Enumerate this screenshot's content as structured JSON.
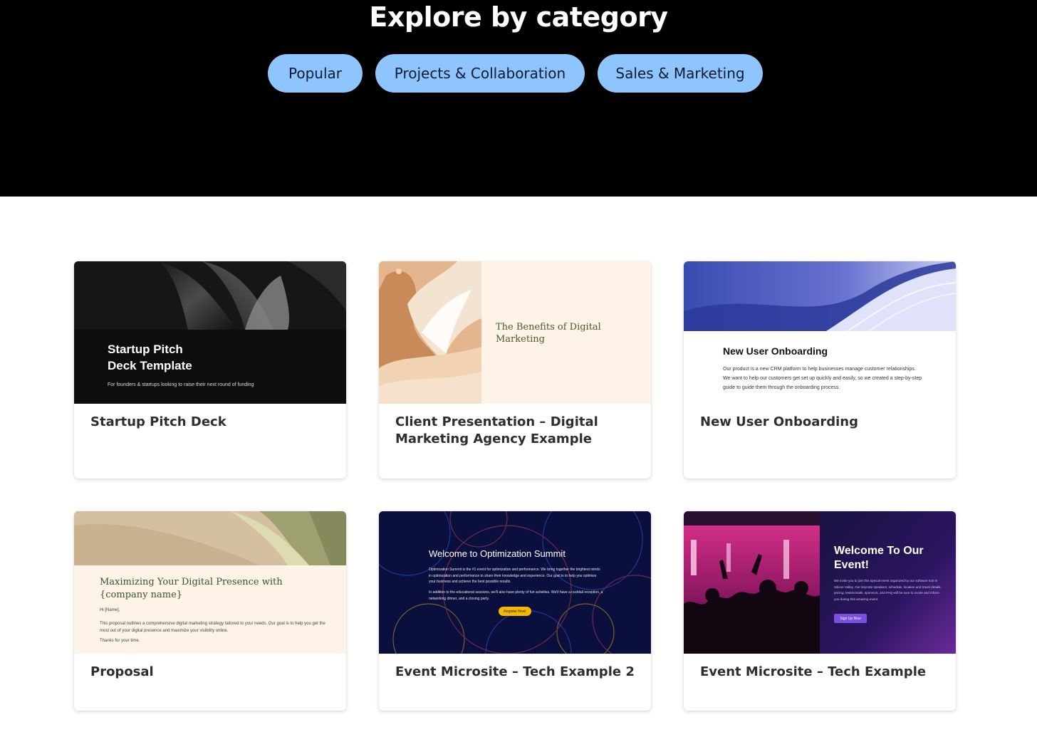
{
  "hero": {
    "title": "Explore by category",
    "categories": [
      "Popular",
      "Projects & Collaboration",
      "Sales & Marketing"
    ]
  },
  "cards": [
    {
      "title": "Startup Pitch Deck",
      "thumb": {
        "heading_line1": "Startup Pitch",
        "heading_line2": "Deck Template",
        "subtitle": "For founders & startups looking to raise their next round of funding"
      }
    },
    {
      "title": "Client Presentation – Digital Marketing Agency Example",
      "thumb": {
        "heading": "The Benefits of Digital Marketing"
      }
    },
    {
      "title": "New User Onboarding",
      "thumb": {
        "heading": "New User Onboarding",
        "body": "Our product is a new CRM platform to help businesses manage customer relationships. We want to help our customers get set up quickly and easily, so we created a step-by-step guide to guide them through the onboarding process."
      }
    },
    {
      "title": "Proposal",
      "thumb": {
        "heading": "Maximizing Your Digital Presence with {company name}",
        "greeting": "Hi [Name],",
        "body": "This proposal outlines a comprehensive digital marketing strategy tailored to your needs. Our goal is to help you get the most out of your digital presence and maximize your visibility online.",
        "closing": "Thanks for your time."
      }
    },
    {
      "title": "Event Microsite – Tech Example 2",
      "thumb": {
        "heading": "Welcome to Optimization Summit",
        "body1": "Optimization Summit is the #1 event for optimization and performance. We bring together the brightest minds in optimization and performance to share their knowledge and experience. Our goal is to help you optimize your business and achieve the best possible results.",
        "body2": "In addition to the educational sessions, we'll also have plenty of fun activities. We'll have a cocktail reception, a networking dinner, and a closing party.",
        "button": "Register Now!"
      }
    },
    {
      "title": "Event Microsite – Tech Example",
      "thumb": {
        "heading": "Welcome To Our Event!",
        "body": "We invite you to join this special event organized by our software tool in Silicon Valley. Our keynote speakers, schedule, location and travel details, pricing, testimonials, sponsors, and FAQ will be sure to excite and inform you during this amazing event.",
        "button": "Sign Up Now"
      }
    }
  ],
  "colors": {
    "pill_bg": "#8ec5fd",
    "pill_text": "#0d1a33",
    "hero_bg": "#000000",
    "card_title": "#2e2e2e",
    "summit_button": "#f5b800",
    "event_button": "#7b4fe0"
  }
}
